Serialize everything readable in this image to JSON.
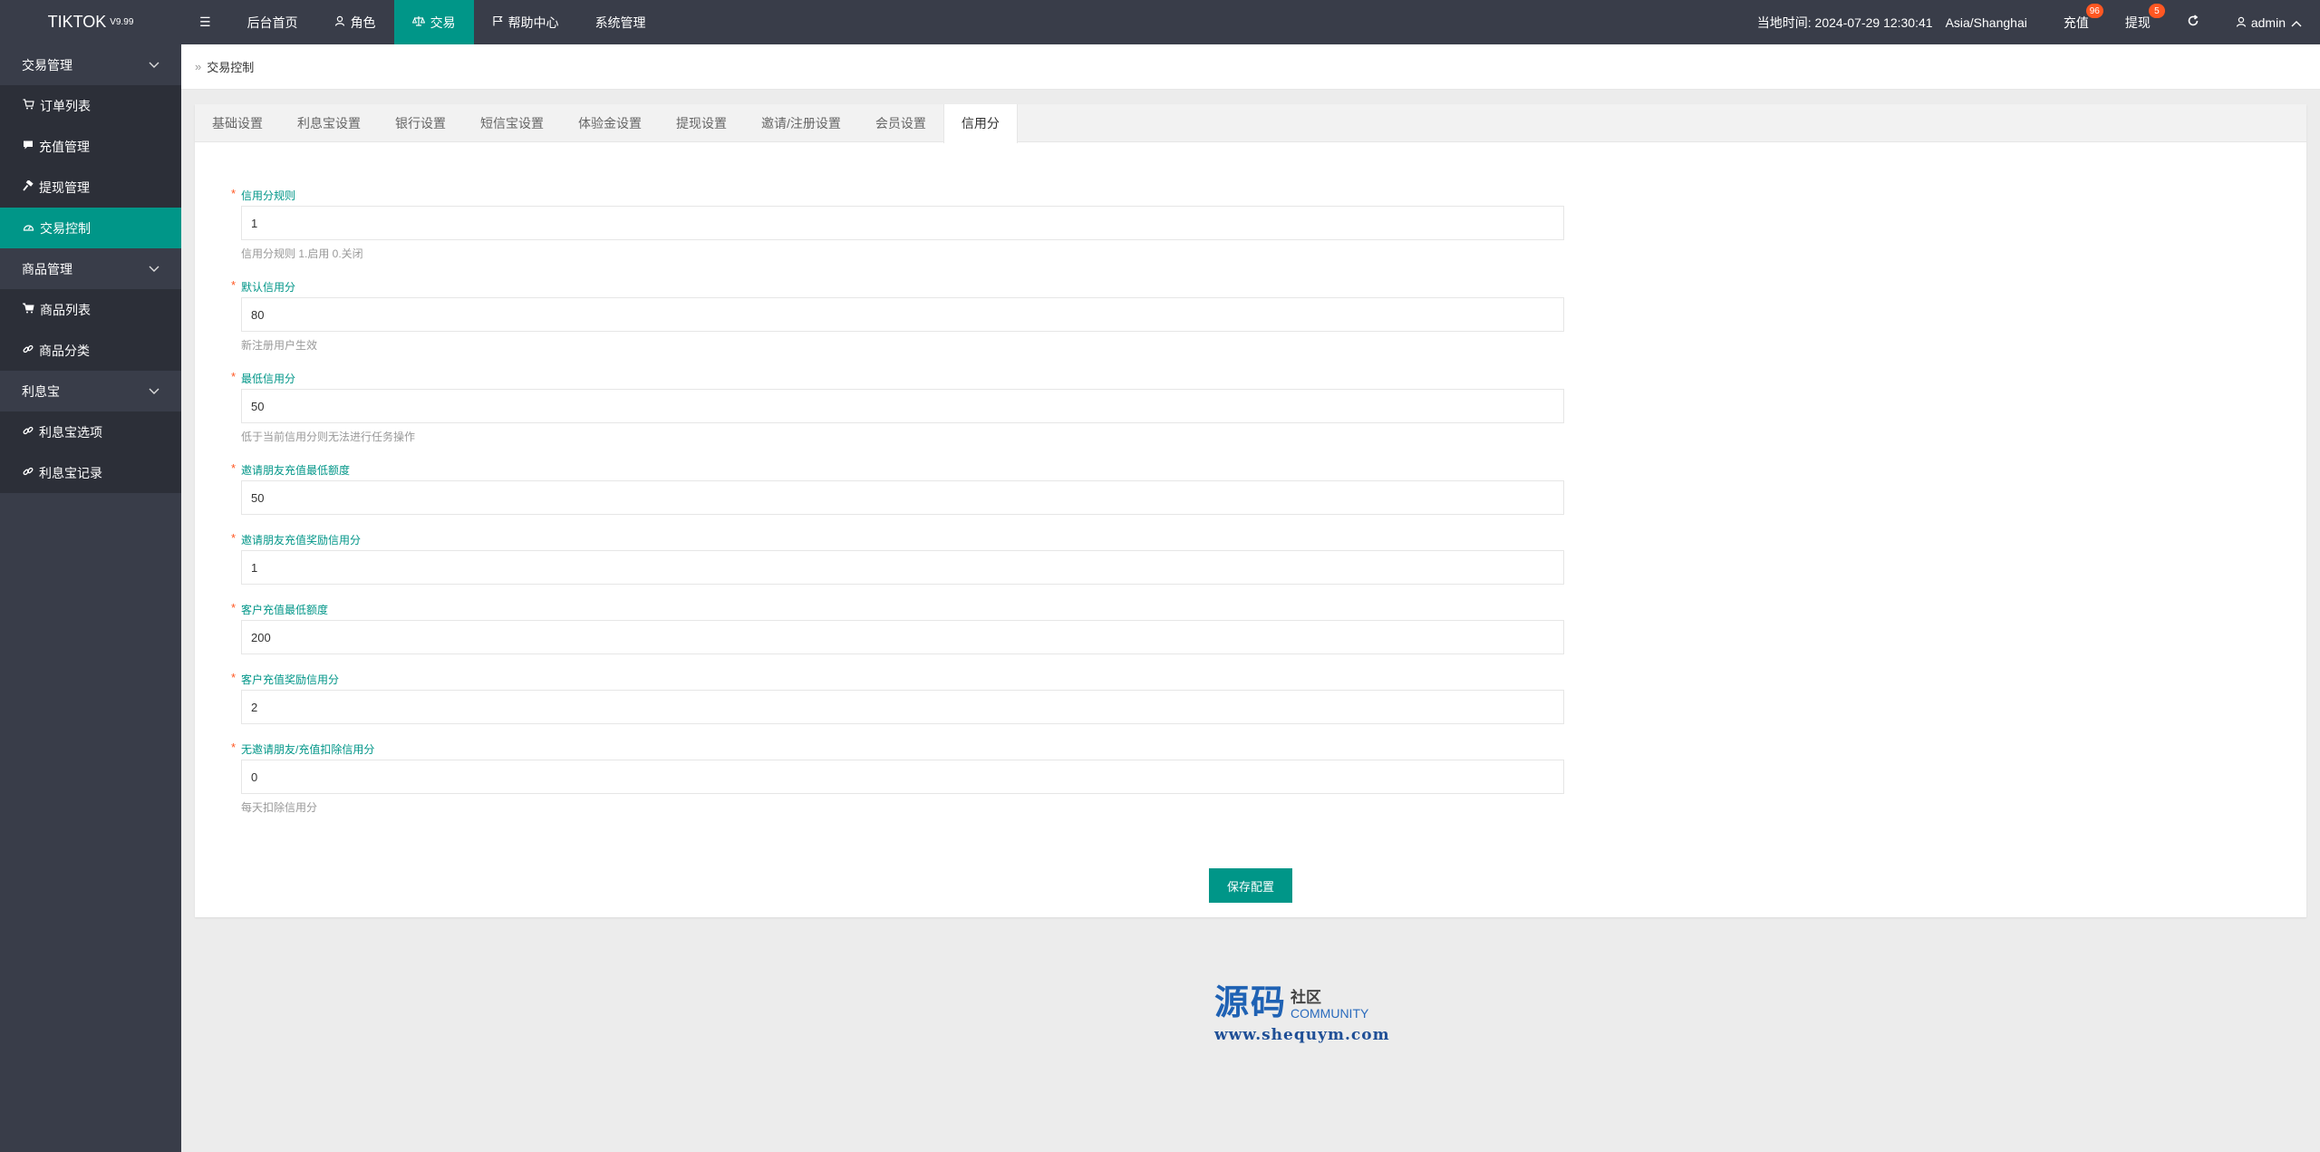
{
  "app": {
    "title": "TIKTOK",
    "version": "V9.99"
  },
  "topnav": {
    "menu_icon": "menu-icon",
    "items": [
      {
        "label": "后台首页",
        "icon": ""
      },
      {
        "label": "角色",
        "icon": "user-icon"
      },
      {
        "label": "交易",
        "icon": "balance-icon",
        "active": true
      },
      {
        "label": "帮助中心",
        "icon": "flag-icon"
      },
      {
        "label": "系统管理",
        "icon": ""
      }
    ],
    "time_label": "当地时间: 2024-07-29 12:30:41",
    "timezone": "Asia/Shanghai",
    "recharge_label": "充值",
    "recharge_badge": "96",
    "withdraw_label": "提现",
    "withdraw_badge": "5",
    "refresh_icon": "refresh-icon",
    "user_label": "admin"
  },
  "sidebar": {
    "groups": [
      {
        "label": "交易管理",
        "items": [
          {
            "label": "订单列表",
            "icon": "cart-icon"
          },
          {
            "label": "充值管理",
            "icon": "comment-icon"
          },
          {
            "label": "提现管理",
            "icon": "hammer-icon"
          },
          {
            "label": "交易控制",
            "icon": "dashboard-icon",
            "active": true
          }
        ]
      },
      {
        "label": "商品管理",
        "items": [
          {
            "label": "商品列表",
            "icon": "cart-icon"
          },
          {
            "label": "商品分类",
            "icon": "link-icon"
          }
        ]
      },
      {
        "label": "利息宝",
        "items": [
          {
            "label": "利息宝选项",
            "icon": "link-icon"
          },
          {
            "label": "利息宝记录",
            "icon": "link-icon"
          }
        ]
      }
    ]
  },
  "breadcrumb": {
    "label": "交易控制"
  },
  "tabs": [
    {
      "label": "基础设置"
    },
    {
      "label": "利息宝设置"
    },
    {
      "label": "银行设置"
    },
    {
      "label": "短信宝设置"
    },
    {
      "label": "体验金设置"
    },
    {
      "label": "提现设置"
    },
    {
      "label": "邀请/注册设置"
    },
    {
      "label": "会员设置"
    },
    {
      "label": "信用分",
      "active": true
    }
  ],
  "form": {
    "fields": [
      {
        "label": "信用分规则",
        "value": "1",
        "hint": "信用分规则 1.启用 0.关闭"
      },
      {
        "label": "默认信用分",
        "value": "80",
        "hint": "新注册用户生效"
      },
      {
        "label": "最低信用分",
        "value": "50",
        "hint": "低于当前信用分则无法进行任务操作"
      },
      {
        "label": "邀请朋友充值最低额度",
        "value": "50",
        "hint": ""
      },
      {
        "label": "邀请朋友充值奖励信用分",
        "value": "1",
        "hint": ""
      },
      {
        "label": "客户充值最低额度",
        "value": "200",
        "hint": ""
      },
      {
        "label": "客户充值奖励信用分",
        "value": "2",
        "hint": ""
      },
      {
        "label": "无邀请朋友/充值扣除信用分",
        "value": "0",
        "hint": "每天扣除信用分"
      }
    ],
    "required_mark": "*",
    "save_label": "保存配置"
  },
  "watermark": {
    "big": "源码",
    "small": "社区",
    "community": "COMMUNITY",
    "url": "www.shequym.com"
  },
  "colors": {
    "accent": "#009688",
    "dark": "#393d49",
    "badge": "#ff5722"
  }
}
